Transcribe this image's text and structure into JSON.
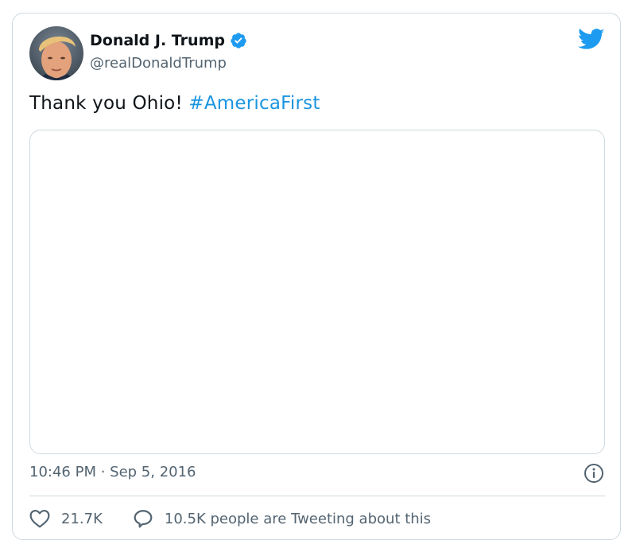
{
  "tweet": {
    "author": {
      "name": "Donald J. Trump",
      "handle": "@realDonaldTrump",
      "verified": true
    },
    "text": "Thank you Ohio!",
    "hashtag": "#AmericaFirst",
    "time": "10:46 PM",
    "separator": " · ",
    "date": "Sep 5, 2016",
    "likes": "21.7K",
    "conversation": "10.5K people are Tweeting about this"
  },
  "icons": {
    "brand": "twitter-bird-icon",
    "verified": "verified-badge-icon",
    "info": "info-icon",
    "like": "heart-icon",
    "reply": "speech-bubble-icon"
  },
  "colors": {
    "brand": "#1d9bf0",
    "hashtag": "#1b95e0",
    "text": "#0f1419",
    "muted": "#536471",
    "border": "#cfd9de"
  }
}
